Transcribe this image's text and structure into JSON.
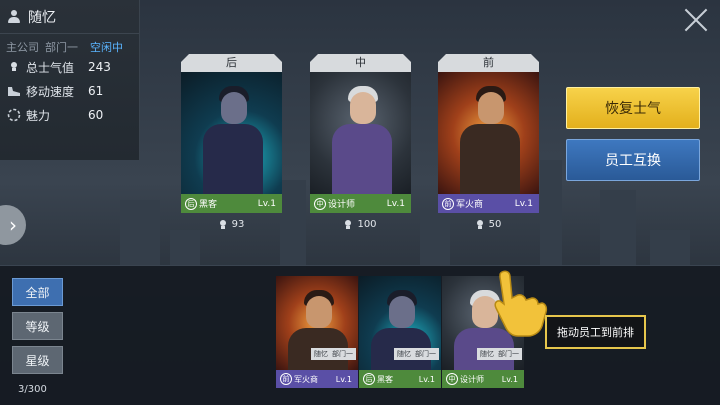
{
  "profile": {
    "name": "随忆",
    "company": "主公司",
    "department": "部门一",
    "status": "空闲中",
    "stats": [
      {
        "icon": "bulb-icon",
        "label": "总士气值",
        "value": "243"
      },
      {
        "icon": "shoe-icon",
        "label": "移动速度",
        "value": "61"
      },
      {
        "icon": "charm-icon",
        "label": "魅力",
        "value": "60"
      }
    ]
  },
  "formation": [
    {
      "position": "后",
      "role_badge": "后",
      "role": "黑客",
      "level": "Lv.1",
      "power": "93",
      "foot_color": "#4e8a3c"
    },
    {
      "position": "中",
      "role_badge": "中",
      "role": "设计师",
      "level": "Lv.1",
      "power": "100",
      "foot_color": "#4e8a3c"
    },
    {
      "position": "前",
      "role_badge": "前",
      "role": "军火商",
      "level": "Lv.1",
      "power": "50",
      "foot_color": "#5a4fa6"
    }
  ],
  "actions": {
    "restore_morale": "恢复士气",
    "swap_employee": "员工互换"
  },
  "filters": [
    {
      "label": "全部",
      "active": true
    },
    {
      "label": "等级",
      "active": false
    },
    {
      "label": "星级",
      "active": false
    }
  ],
  "roster_count": "3/300",
  "roster": [
    {
      "role_badge": "前",
      "role": "军火商",
      "level": "Lv.1",
      "owner": "随忆",
      "dept": "部门一",
      "foot_color": "#5a4fa6"
    },
    {
      "role_badge": "后",
      "role": "黑客",
      "level": "Lv.1",
      "owner": "随忆",
      "dept": "部门一",
      "foot_color": "#4e8a3c"
    },
    {
      "role_badge": "中",
      "role": "设计师",
      "level": "Lv.1",
      "owner": "随忆",
      "dept": "部门一",
      "foot_color": "#4e8a3c"
    }
  ],
  "tutorial_hint": "拖动员工到前排",
  "colors": {
    "accent_yellow": "#f0c436",
    "accent_blue": "#3a70b5",
    "status_blue": "#5ab4ff"
  }
}
